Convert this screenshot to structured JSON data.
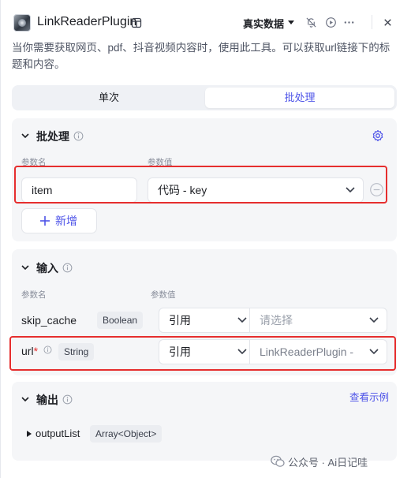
{
  "header": {
    "title": "LinkReaderPlugin",
    "data_mode": "真实数据"
  },
  "description": "当你需要获取网页、pdf、抖音视频内容时，使用此工具。可以获取url链接下的标题和内容。",
  "tabs": [
    {
      "label": "单次",
      "active": false
    },
    {
      "label": "批处理",
      "active": true
    }
  ],
  "batch": {
    "title": "批处理",
    "col_name": "参数名",
    "col_value": "参数值",
    "item_name": "item",
    "item_value": "代码 - key",
    "add_label": "新增"
  },
  "input": {
    "title": "输入",
    "col_name": "参数名",
    "col_value": "参数值",
    "params": [
      {
        "name": "skip_cache",
        "type": "Boolean",
        "ref_mode": "引用",
        "value": "请选择",
        "required": false
      },
      {
        "name": "url",
        "type": "String",
        "ref_mode": "引用",
        "value": "LinkReaderPlugin -",
        "required": true
      }
    ]
  },
  "output": {
    "title": "输出",
    "example_link": "查看示例",
    "items": [
      {
        "name": "outputList",
        "type": "Array<Object>"
      }
    ]
  },
  "watermark": "公众号 · Ai日记哇",
  "colors": {
    "accent": "#4d53e8",
    "highlight": "#e62e2e"
  }
}
